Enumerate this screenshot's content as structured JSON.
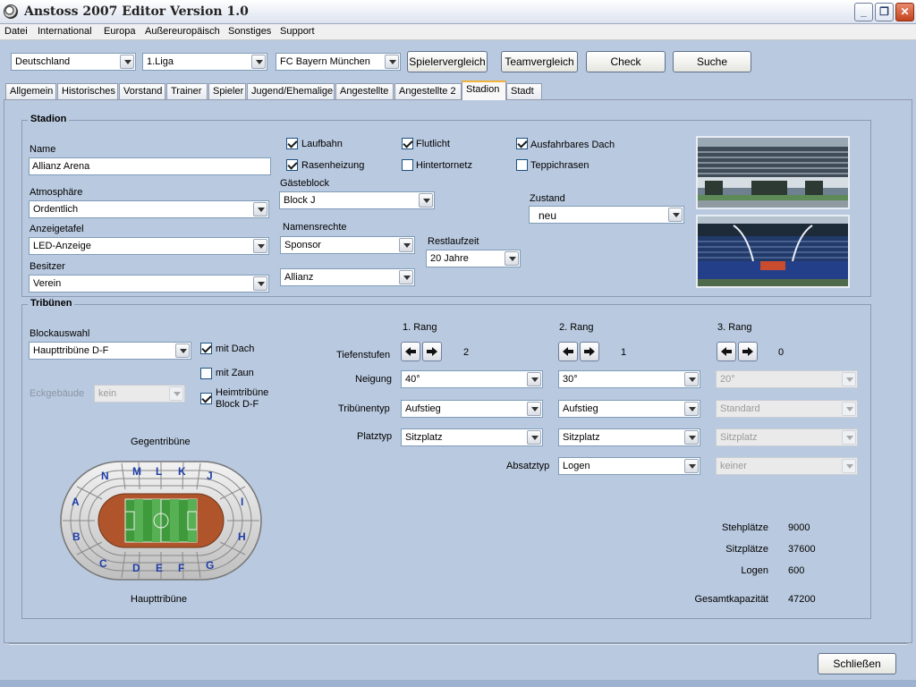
{
  "window": {
    "title": "Anstoss 2007 Editor  Version 1.0",
    "controls": {
      "minimize": "_",
      "restore": "❐",
      "close": "✕"
    }
  },
  "menu": [
    "Datei",
    "International",
    "Europa",
    "Außereuropäisch",
    "Sonstiges",
    "Support"
  ],
  "toolbar": {
    "country": "Deutschland",
    "league": "1.Liga",
    "team": "FC Bayern München",
    "buttons": [
      "Spielervergleich",
      "Teamvergleich",
      "Check",
      "Suche"
    ]
  },
  "tabs": [
    "Allgemein",
    "Historisches",
    "Vorstand",
    "Trainer",
    "Spieler",
    "Jugend/Ehemalige",
    "Angestellte",
    "Angestellte 2",
    "Stadion",
    "Stadt"
  ],
  "active_tab": "Stadion",
  "stadion": {
    "legend": "Stadion",
    "name_label": "Name",
    "name_value": "Allianz Arena",
    "atmosphaere_label": "Atmosphäre",
    "atmosphaere_value": "Ordentlich",
    "anzeigetafel_label": "Anzeigetafel",
    "anzeigetafel_value": "LED-Anzeige",
    "besitzer_label": "Besitzer",
    "besitzer_value": "Verein",
    "checkboxes": [
      {
        "label": "Laufbahn",
        "checked": true
      },
      {
        "label": "Rasenheizung",
        "checked": true
      },
      {
        "label": "Flutlicht",
        "checked": true
      },
      {
        "label": "Hintertornetz",
        "checked": false
      },
      {
        "label": "Ausfahrbares Dach",
        "checked": true
      },
      {
        "label": "Teppichrasen",
        "checked": false
      }
    ],
    "gaesteblock_label": "Gästeblock",
    "gaesteblock_value": "Block J",
    "namensrechte_label": "Namensrechte",
    "namensrechte_value": "Sponsor",
    "sponsor_value": "Allianz",
    "restlaufzeit_label": "Restlaufzeit",
    "restlaufzeit_value": "20 Jahre",
    "zustand_label": "Zustand",
    "zustand_value": "neu"
  },
  "tribuenen": {
    "legend": "Tribünen",
    "blockauswahl_label": "Blockauswahl",
    "blockauswahl_value": "Haupttribüne D-F",
    "mit_dach_label": "mit Dach",
    "mit_dach_checked": true,
    "mit_zaun_label": "mit Zaun",
    "mit_zaun_checked": false,
    "heimtribuene_label_1": "Heimtribüne",
    "heimtribuene_label_2": "Block D-F",
    "heimtribuene_checked": true,
    "eckgebaeude_label": "Eckgebäude",
    "eckgebaeude_value": "kein",
    "gegentribuene_label": "Gegentribüne",
    "haupttribuene_label": "Haupttribüne",
    "stadium_blocks": [
      "N",
      "M",
      "L",
      "K",
      "J",
      "A",
      "I",
      "B",
      "H",
      "C",
      "D",
      "E",
      "F",
      "G"
    ],
    "rang_headers": [
      "1. Rang",
      "2. Rang",
      "3. Rang"
    ],
    "row_labels": {
      "tiefenstufen": "Tiefenstufen",
      "neigung": "Neigung",
      "tribuenentyp": "Tribünentyp",
      "platztyp": "Platztyp",
      "absatztyp": "Absatztyp"
    },
    "tiefenstufen_values": [
      "2",
      "1",
      "0"
    ],
    "neigung_values": [
      "40°",
      "30°",
      "20°"
    ],
    "tribuenentyp_values": [
      "Aufstieg",
      "Aufstieg",
      "Standard"
    ],
    "platztyp_values": [
      "Sitzplatz",
      "Sitzplatz",
      "Sitzplatz"
    ],
    "absatztyp_values": [
      "Logen",
      "keiner"
    ],
    "capacity": [
      {
        "label": "Stehplätze",
        "value": "9000"
      },
      {
        "label": "Sitzplätze",
        "value": "37600"
      },
      {
        "label": "Logen",
        "value": "600"
      },
      {
        "label": "Gesamtkapazität",
        "value": "47200"
      }
    ]
  },
  "footer": {
    "close_button": "Schließen"
  }
}
